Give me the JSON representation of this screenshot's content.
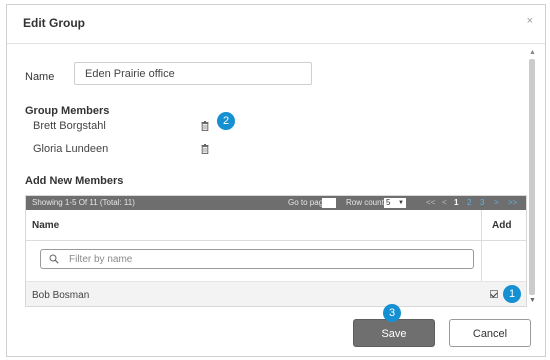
{
  "dialog": {
    "title": "Edit Group",
    "close_glyph": "×"
  },
  "name_field": {
    "label": "Name",
    "value": "Eden Prairie office"
  },
  "group_members": {
    "title": "Group Members",
    "members": [
      {
        "name": "Brett Borgstahl"
      },
      {
        "name": "Gloria Lundeen"
      }
    ]
  },
  "add_new_members": {
    "title": "Add New Members",
    "pager": {
      "showing_text": "Showing 1-5 Of 11 (Total: 11)",
      "goto_label": "Go to page:",
      "row_count_label": "Row count:",
      "row_count_value": "5",
      "first": "<<",
      "prev": "<",
      "pages": [
        "1",
        "2",
        "3"
      ],
      "current_page": "1",
      "next": ">",
      "last": ">>"
    },
    "columns": {
      "name": "Name",
      "add": "Add"
    },
    "filter_placeholder": "Filter by name",
    "rows": [
      {
        "name": "Bob Bosman",
        "add_checked": true
      }
    ]
  },
  "callouts": {
    "one": "1",
    "two": "2",
    "three": "3"
  },
  "footer": {
    "save_label": "Save",
    "cancel_label": "Cancel"
  },
  "colors": {
    "accent": "#1591d3",
    "pager_bg": "#6e6e6e",
    "save_bg": "#6f6f6f"
  },
  "icons": {
    "close": "close-icon",
    "trash": "trash-icon",
    "search": "search-icon",
    "checkbox": "checkbox-icon"
  }
}
